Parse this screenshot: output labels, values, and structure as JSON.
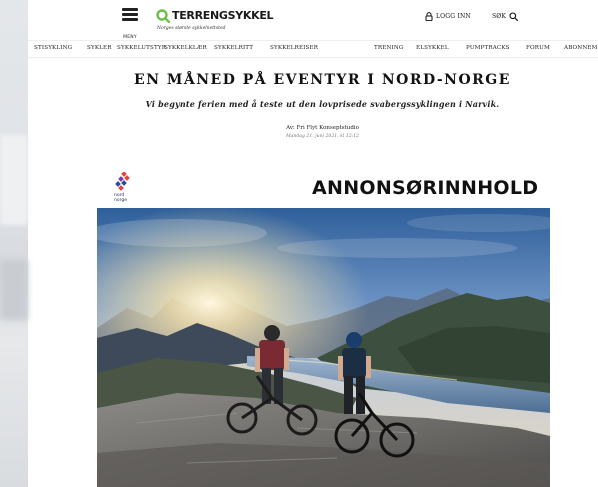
{
  "header": {
    "menu_label": "MENY",
    "logo_text": "TERRENGSYKKEL",
    "tagline": "Norges største sykkelnettsted",
    "login_label": "LOGG INN",
    "search_label": "SØK"
  },
  "nav": {
    "items": [
      "STISYKLING",
      "SYKLER",
      "SYKKELUTSTYR",
      "SYKKELKLÆR",
      "SYKKELRITT",
      "SYKKELREISER",
      "TRENING",
      "ELSYKKEL",
      "PUMPTRACKS",
      "FORUM",
      "ABONNEM"
    ]
  },
  "article": {
    "title": "EN MÅNED PÅ EVENTYR I NORD-NORGE",
    "lead": "Vi begynte ferien med å teste ut den lovprisede svabergssyklingen i Narvik.",
    "byline": "Av: Fri Flyt Konseptstudio",
    "date": "Mandag 21. juni 2021. kl 12:12"
  },
  "sponsor": {
    "logo_text_line1": "nord",
    "logo_text_line2": "norge",
    "label": "ANNONSØRINNHOLD"
  },
  "colors": {
    "brand_green": "#6cc04a",
    "sponsor_red": "#e8423b",
    "sponsor_blue": "#2b4aa3",
    "sponsor_purple": "#7b3fa0"
  },
  "icons": {
    "menu": "hamburger-icon",
    "login": "lock-icon",
    "search": "search-icon",
    "logo": "logo-mark-icon"
  }
}
